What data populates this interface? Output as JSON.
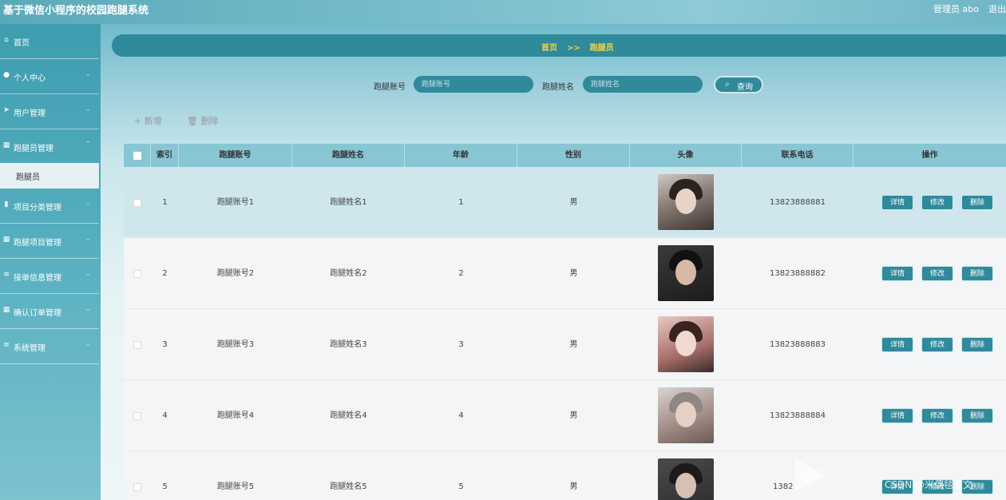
{
  "header": {
    "app_title": "基于微信小程序的校园跑腿系统",
    "user": "管理员 abo",
    "logout": "退出"
  },
  "sidebar": {
    "items": [
      {
        "label": "首页",
        "icon": "home-icon",
        "glyph": "⌂"
      },
      {
        "label": "个人中心",
        "icon": "user-icon",
        "glyph": "●"
      },
      {
        "label": "用户管理",
        "icon": "send-icon",
        "glyph": "➤"
      },
      {
        "label": "跑腿员管理",
        "icon": "grid-icon",
        "glyph": "▦"
      },
      {
        "label": "项目分类管理",
        "icon": "bar-chart-icon",
        "glyph": "▮"
      },
      {
        "label": "跑腿项目管理",
        "icon": "grid-icon",
        "glyph": "▦"
      },
      {
        "label": "接单信息管理",
        "icon": "sliders-icon",
        "glyph": "≡"
      },
      {
        "label": "确认订单管理",
        "icon": "grid-icon",
        "glyph": "▦"
      },
      {
        "label": "系统管理",
        "icon": "menu-icon",
        "glyph": "≡"
      }
    ],
    "active_sub": "跑腿员"
  },
  "breadcrumb": {
    "home": "首页",
    "sep": ">>",
    "current": "跑腿员"
  },
  "search": {
    "account_label": "跑腿账号",
    "account_placeholder": "跑腿账号",
    "name_label": "跑腿姓名",
    "name_placeholder": "跑腿姓名",
    "query_label": "查询"
  },
  "actions": {
    "add": "新增",
    "delete": "删除"
  },
  "table": {
    "columns": [
      "索引",
      "跑腿账号",
      "跑腿姓名",
      "年龄",
      "性别",
      "头像",
      "联系电话",
      "操作"
    ],
    "rows": [
      {
        "index": "1",
        "account": "跑腿账号1",
        "name": "跑腿姓名1",
        "age": "1",
        "gender": "男",
        "phone": "13823888881"
      },
      {
        "index": "2",
        "account": "跑腿账号2",
        "name": "跑腿姓名2",
        "age": "2",
        "gender": "男",
        "phone": "13823888882"
      },
      {
        "index": "3",
        "account": "跑腿账号3",
        "name": "跑腿姓名3",
        "age": "3",
        "gender": "男",
        "phone": "13823888883"
      },
      {
        "index": "4",
        "account": "跑腿账号4",
        "name": "跑腿姓名4",
        "age": "4",
        "gender": "男",
        "phone": "13823888884"
      },
      {
        "index": "5",
        "account": "跑腿账号5",
        "name": "跑腿姓名5",
        "age": "5",
        "gender": "男",
        "phone": "1382"
      }
    ],
    "op_detail": "详情",
    "op_edit": "修改",
    "op_delete": "删除"
  },
  "watermark": "CSDN @米偶毯王文"
}
